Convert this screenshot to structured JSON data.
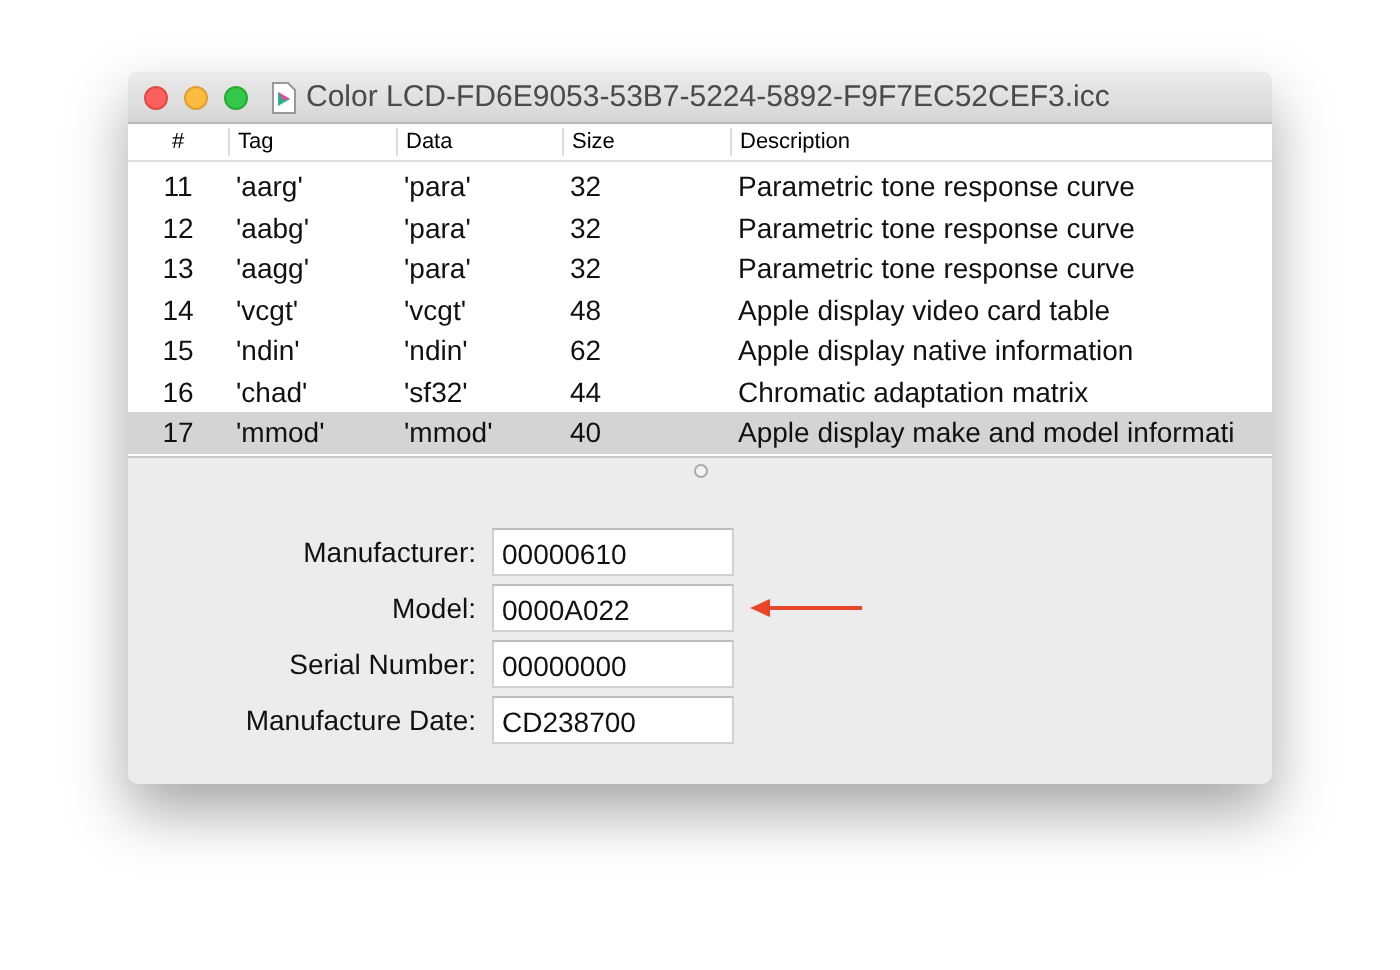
{
  "window": {
    "title": "Color LCD-FD6E9053-53B7-5224-5892-F9F7EC52CEF3.icc"
  },
  "table": {
    "columns": [
      "#",
      "Tag",
      "Data",
      "Size",
      "Description"
    ],
    "rows": [
      {
        "cells": [
          "11",
          "'aarg'",
          "'para'",
          "32",
          "Parametric tone response curve"
        ],
        "selected": false
      },
      {
        "cells": [
          "12",
          "'aabg'",
          "'para'",
          "32",
          "Parametric tone response curve"
        ],
        "selected": false
      },
      {
        "cells": [
          "13",
          "'aagg'",
          "'para'",
          "32",
          "Parametric tone response curve"
        ],
        "selected": false
      },
      {
        "cells": [
          "14",
          "'vcgt'",
          "'vcgt'",
          "48",
          "Apple display video card table"
        ],
        "selected": false
      },
      {
        "cells": [
          "15",
          "'ndin'",
          "'ndin'",
          "62",
          "Apple display native information"
        ],
        "selected": false
      },
      {
        "cells": [
          "16",
          "'chad'",
          "'sf32'",
          "44",
          "Chromatic adaptation matrix"
        ],
        "selected": false
      },
      {
        "cells": [
          "17",
          "'mmod'",
          "'mmod'",
          "40",
          "Apple display make and model informati"
        ],
        "selected": true
      }
    ]
  },
  "fields": [
    {
      "label": "Manufacturer:",
      "value": "00000610",
      "pointed": false
    },
    {
      "label": "Model:",
      "value": "0000A022",
      "pointed": true
    },
    {
      "label": "Serial Number:",
      "value": "00000000",
      "pointed": false
    },
    {
      "label": "Manufacture Date:",
      "value": "CD238700",
      "pointed": false
    }
  ]
}
